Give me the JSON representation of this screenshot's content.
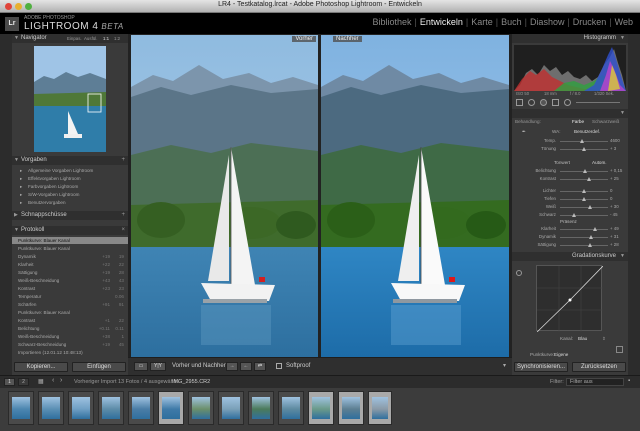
{
  "window": {
    "title": "LR4 - Testkatalog.lrcat - Adobe Photoshop Lightroom - Entwickeln"
  },
  "brand": {
    "line1": "ADOBE PHOTOSHOP",
    "line2": "LIGHTROOM 4",
    "beta": "BETA",
    "logo": "Lr"
  },
  "modules": [
    "Bibliothek",
    "Entwickeln",
    "Karte",
    "Buch",
    "Diashow",
    "Drucken",
    "Web"
  ],
  "navigator": {
    "title": "Navigator",
    "zoom": [
      "Einpas.",
      "Ausfül.",
      "1:1",
      "1:2"
    ]
  },
  "presets": {
    "title": "Vorgaben",
    "items": [
      "Allgemeine Vorgaben Lightroom",
      "Effektvorgaben Lightroom",
      "Farbvorgaben Lightroom",
      "S/W-Vorgaben Lightroom",
      "Benutzervorgaben"
    ]
  },
  "snapshots": {
    "title": "Schnappschüsse"
  },
  "history": {
    "title": "Protokoll",
    "rows": [
      {
        "label": "Punktkurve: Blauer Kanal",
        "a": "",
        "b": ""
      },
      {
        "label": "Punktkurve: Blauer Kanal",
        "a": "",
        "b": ""
      },
      {
        "label": "Dynamik",
        "a": "+19",
        "b": "19"
      },
      {
        "label": "Klarheit",
        "a": "+22",
        "b": "22"
      },
      {
        "label": "Sättigung",
        "a": "+19",
        "b": "28"
      },
      {
        "label": "Weiß-Beschneidung",
        "a": "+43",
        "b": "43"
      },
      {
        "label": "Kontrast",
        "a": "+23",
        "b": "23"
      },
      {
        "label": "Temperatur",
        "a": "",
        "b": "0.06"
      },
      {
        "label": "Schärfen",
        "a": "+91",
        "b": "91"
      },
      {
        "label": "Punktkurve: Blauer Kanal",
        "a": "",
        "b": ""
      },
      {
        "label": "Kontrast",
        "a": "+1",
        "b": "22"
      },
      {
        "label": "Belichtung",
        "a": "+0.11",
        "b": "0.11"
      },
      {
        "label": "Weiß-Beschneidung",
        "a": "+38",
        "b": "1"
      },
      {
        "label": "Schwarz-Beschneidung",
        "a": "+19",
        "b": "45"
      },
      {
        "label": "Importieren (12.01.12 10:48:13)",
        "a": "",
        "b": ""
      }
    ]
  },
  "left_buttons": {
    "copy": "Kopieren...",
    "paste": "Einfügen"
  },
  "view": {
    "before": "Vorher",
    "after": "Nachher"
  },
  "toolbar": {
    "before_after_label": "Vorher und Nachher:",
    "softproof": "Softproof"
  },
  "histogram": {
    "title": "Histogramm",
    "info": [
      "ISO 50",
      "18 mm",
      "f / 8.0",
      "1/320 Sek."
    ]
  },
  "basic": {
    "tabs": [
      "Behandlung:",
      "Farbe",
      "Schwarzweiß"
    ],
    "wb_label": "WA:",
    "wb_value": "Benutzerdef.",
    "tone_label": "Tonwert",
    "auto": "Autom.",
    "presence": "Präsenz",
    "sliders": [
      {
        "label": "Temp.",
        "value": "4600",
        "pos": 0.45
      },
      {
        "label": "Tönung",
        "value": "+ 3",
        "pos": 0.5
      },
      {
        "label": "Belichtung",
        "value": "+ 0,15",
        "pos": 0.52
      },
      {
        "label": "Kontrast",
        "value": "+ 25",
        "pos": 0.6
      },
      {
        "label": "Lichter",
        "value": "0",
        "pos": 0.5
      },
      {
        "label": "Tiefen",
        "value": "0",
        "pos": 0.5
      },
      {
        "label": "Weiß",
        "value": "+ 30",
        "pos": 0.62
      },
      {
        "label": "Schwarz",
        "value": "- 45",
        "pos": 0.3
      },
      {
        "label": "Klarheit",
        "value": "+ 49",
        "pos": 0.72
      },
      {
        "label": "Dynamik",
        "value": "+ 31",
        "pos": 0.64
      },
      {
        "label": "Sättigung",
        "value": "+ 28",
        "pos": 0.62
      }
    ]
  },
  "tone_curve": {
    "title": "Gradationskurve",
    "channel_label": "Kanal:",
    "channel": "Blau",
    "point_curve_label": "Punktkurve:",
    "point_curve": "Eigene"
  },
  "right_buttons": {
    "sync": "Synchronisieren...",
    "reset": "Zurücksetzen"
  },
  "filmbar": {
    "pages": [
      "1",
      "2"
    ],
    "import": "Vorheriger Import",
    "count": "13 Fotos / 4 ausgewählt /",
    "file": "IMG_2955.CR2",
    "filter_label": "Filter:",
    "filter_value": "Filter aus"
  },
  "colors": {
    "bg": "#2a2a2a",
    "panel": "#3a3a3a",
    "accent": "#e8e8e8"
  }
}
